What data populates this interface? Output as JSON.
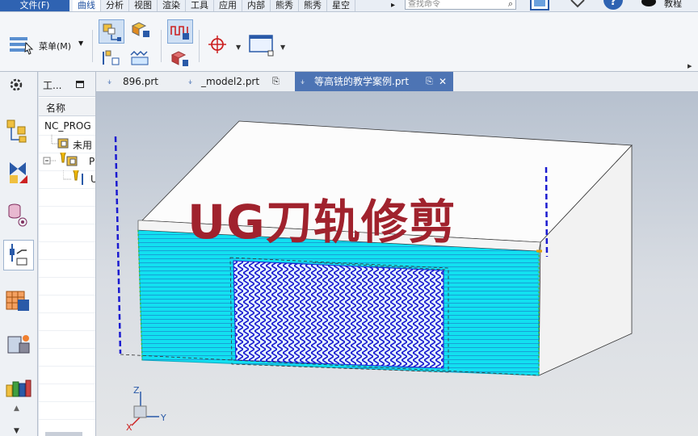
{
  "menubar": {
    "file_label": "文件(F)",
    "tabs": [
      {
        "label": "曲线"
      },
      {
        "label": "分析"
      },
      {
        "label": "视图"
      },
      {
        "label": "渲染"
      },
      {
        "label": "工具"
      },
      {
        "label": "应用"
      },
      {
        "label": "内部"
      },
      {
        "label": "熊秀"
      },
      {
        "label": "熊秀"
      },
      {
        "label": "星空"
      }
    ],
    "active_tab": "曲线",
    "more_arrow": "▸",
    "search_placeholder": "查找命令",
    "tutorial_label": "教程"
  },
  "toolbar": {
    "menu_label": "菜单(M)"
  },
  "navigator": {
    "title": "工...",
    "column_name": "名称",
    "rows": [
      {
        "label": "NC_PROG"
      },
      {
        "label": "未用"
      },
      {
        "label": "P"
      },
      {
        "label": "U"
      }
    ]
  },
  "view_tabs": [
    {
      "label": "896.prt"
    },
    {
      "label": "_model2.prt"
    },
    {
      "label": "等高铣的教学案例.prt"
    }
  ],
  "overlay": {
    "title": "UG刀轨修剪"
  },
  "triad": {
    "z": "Z",
    "y": "Y",
    "x": "X"
  },
  "colors": {
    "accent": "#2f63b2",
    "cut_face": "#00e0f0",
    "toolpath": "#1a1ad0",
    "overlay_text": "#a0222d"
  }
}
